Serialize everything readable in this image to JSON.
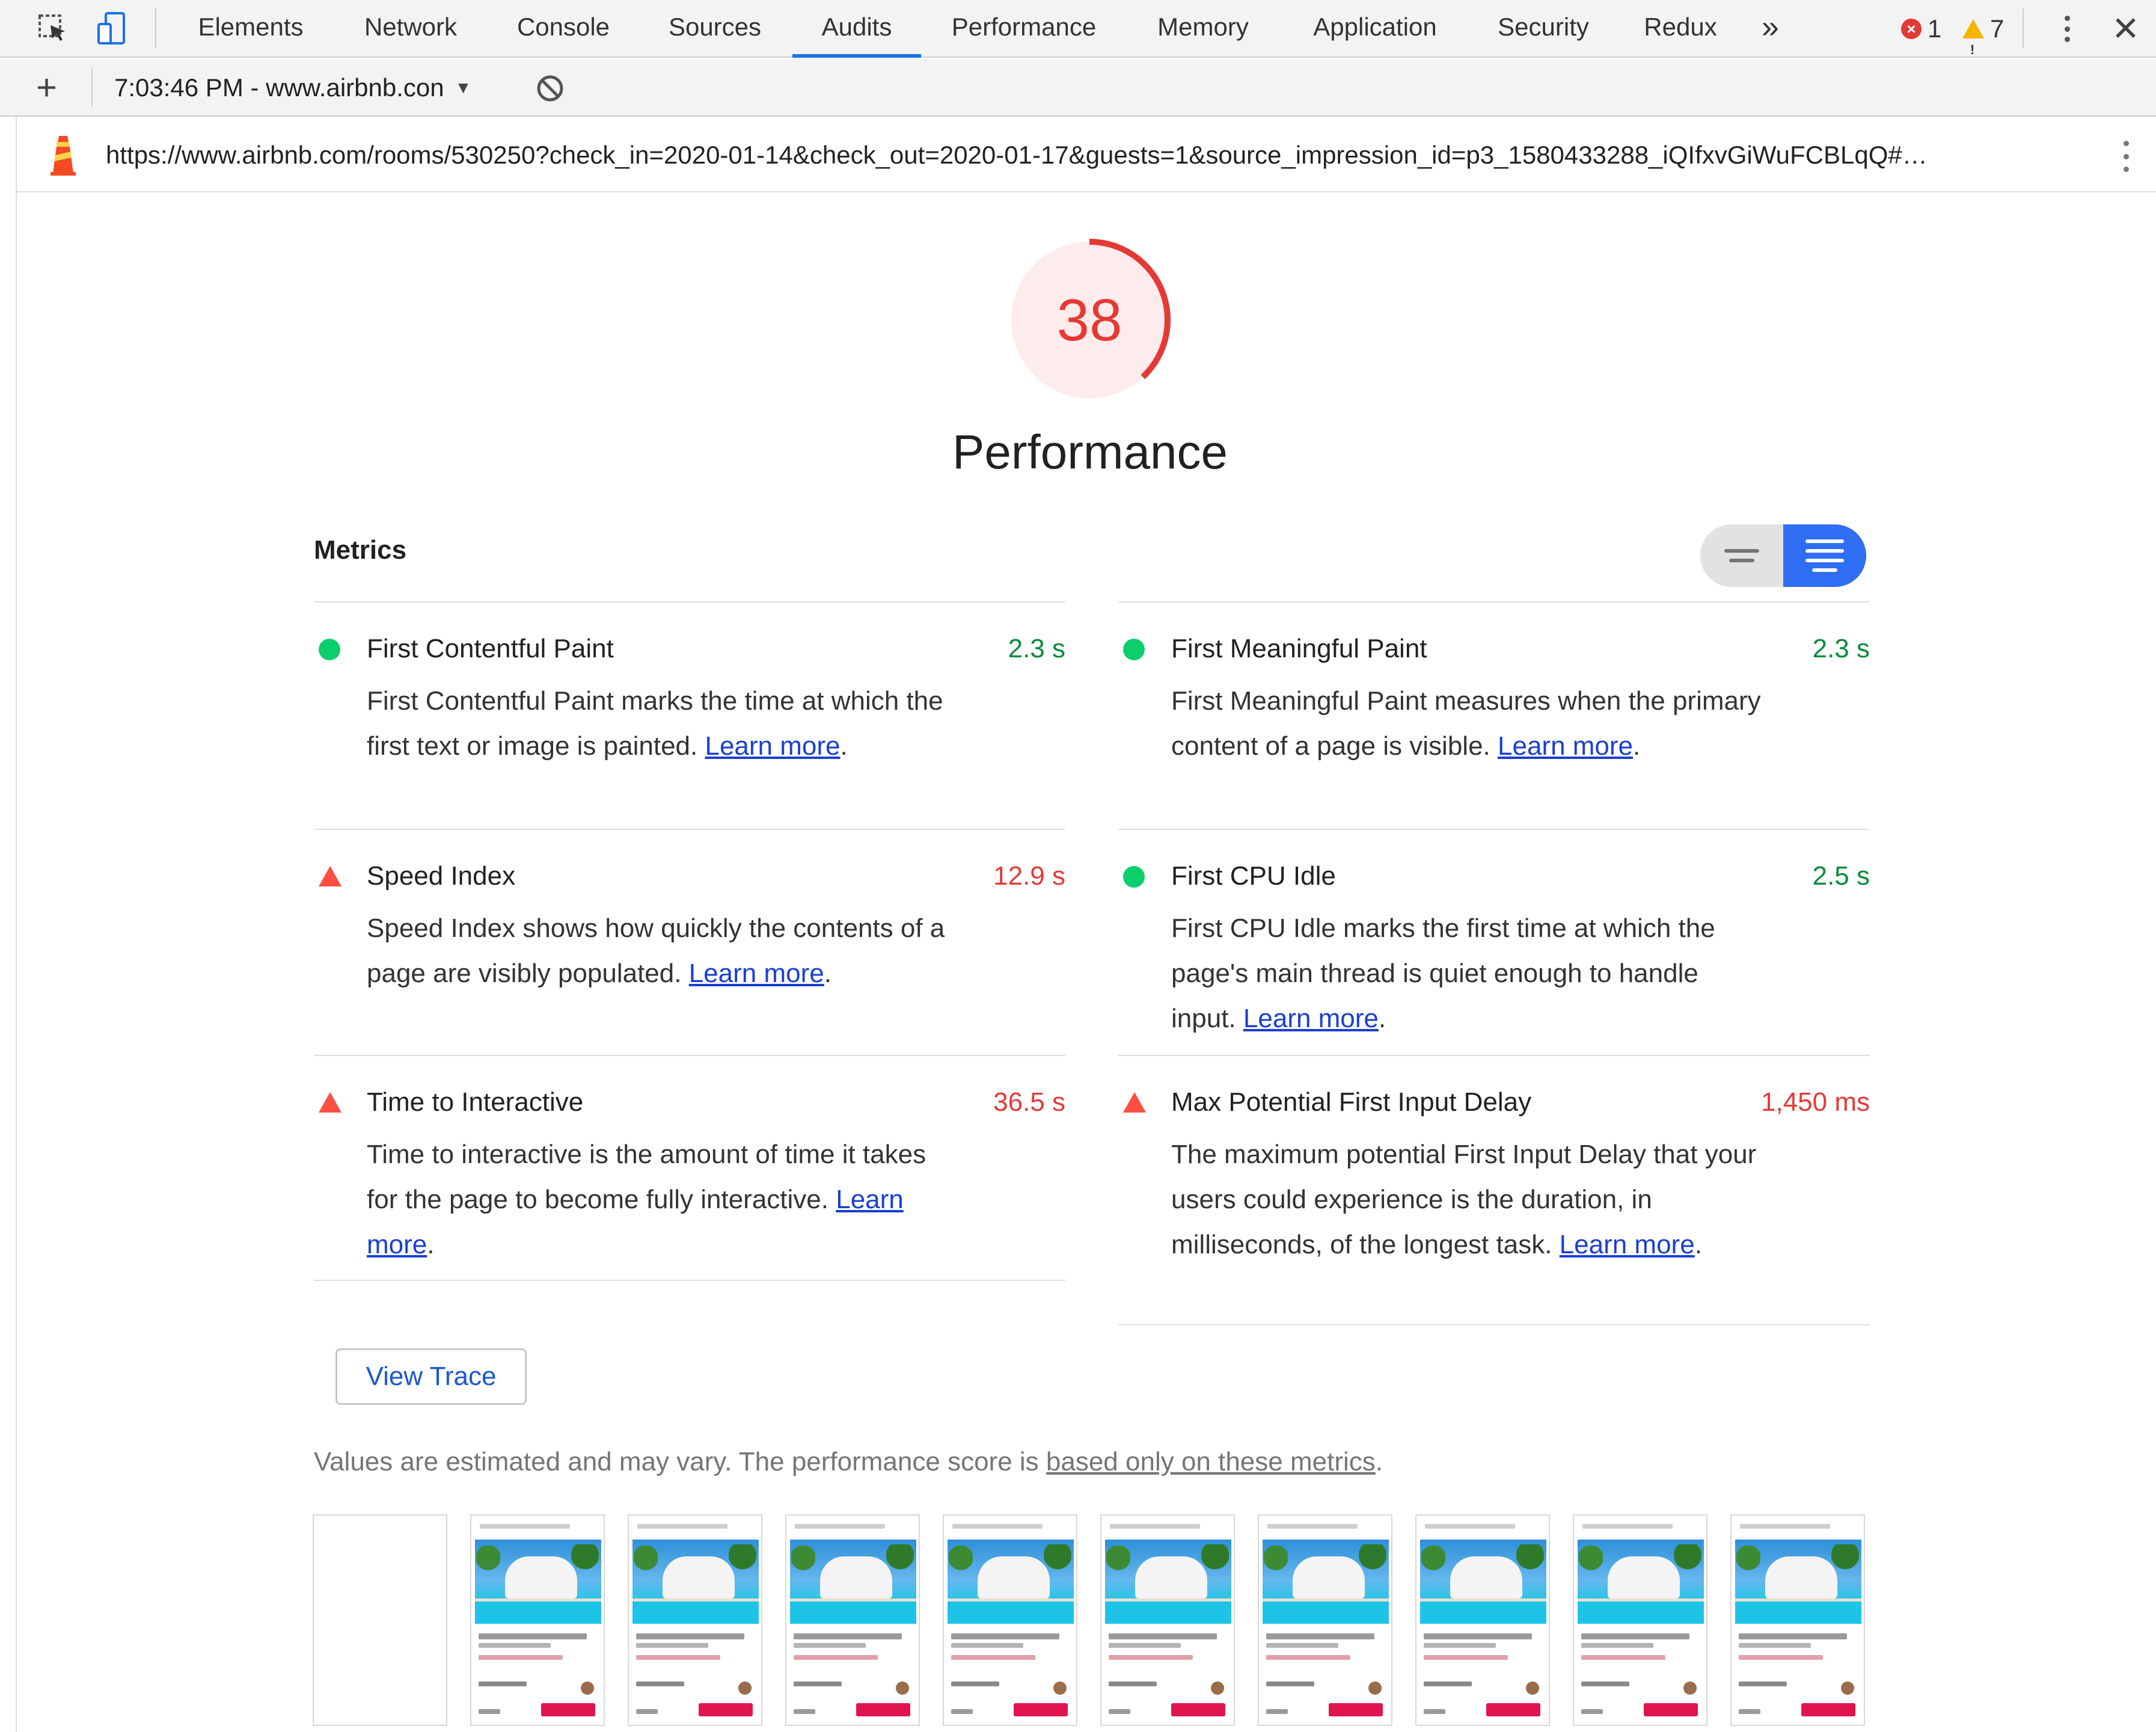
{
  "devtools": {
    "tabs": [
      "Elements",
      "Network",
      "Console",
      "Sources",
      "Audits",
      "Performance",
      "Memory",
      "Application",
      "Security",
      "Redux"
    ],
    "active_tab": "Audits",
    "overflow_glyph": "»",
    "error_count": "1",
    "warning_count": "7",
    "close_glyph": "✕"
  },
  "toolbar": {
    "add_glyph": "+",
    "report_label": "7:03:46 PM - www.airbnb.con",
    "dropdown_glyph": "▼"
  },
  "page": {
    "url": "https://www.airbnb.com/rooms/530250?check_in=2020-01-14&check_out=2020-01-17&guests=1&source_impression_id=p3_1580433288_iQIfxvGiWuFCBLqQ#…"
  },
  "score": {
    "value": "38",
    "fraction": 0.38,
    "color": "#e53935",
    "bg_color": "#fdeceb",
    "category": "Performance"
  },
  "metrics": {
    "header": "Metrics",
    "items": [
      {
        "title": "First Contentful Paint",
        "value": "2.3 s",
        "status": "pass",
        "desc": "First Contentful Paint marks the time at which the first text or image is painted.",
        "link": "Learn more",
        "end": "."
      },
      {
        "title": "First Meaningful Paint",
        "value": "2.3 s",
        "status": "pass",
        "desc": "First Meaningful Paint measures when the primary content of a page is visible.",
        "link": "Learn more",
        "end": "."
      },
      {
        "title": "Speed Index",
        "value": "12.9 s",
        "status": "fail",
        "desc": "Speed Index shows how quickly the contents of a page are visibly populated.",
        "link": "Learn more",
        "end": "."
      },
      {
        "title": "First CPU Idle",
        "value": "2.5 s",
        "status": "pass",
        "desc": "First CPU Idle marks the first time at which the page's main thread is quiet enough to handle input.",
        "link": "Learn more",
        "end": "."
      },
      {
        "title": "Time to Interactive",
        "value": "36.5 s",
        "status": "fail",
        "desc": "Time to interactive is the amount of time it takes for the page to become fully interactive.",
        "link": "Learn more",
        "end": "."
      },
      {
        "title": "Max Potential First Input Delay",
        "value": "1,450 ms",
        "status": "fail",
        "desc": "The maximum potential First Input Delay that your users could experience is the duration, in milliseconds, of the longest task.",
        "link": "Learn more",
        "end": "."
      }
    ]
  },
  "actions": {
    "view_trace": "View Trace"
  },
  "footnote": {
    "text": "Values are estimated and may vary. The performance score is ",
    "link": "based only on these metrics",
    "end": "."
  },
  "filmstrip": {
    "frames": 10,
    "blank_frames": 1
  },
  "colors": {
    "pass": "#0cce6b",
    "fail": "#ff4e42",
    "accent": "#1a73e8",
    "toggle_active": "#2f6ef3"
  }
}
